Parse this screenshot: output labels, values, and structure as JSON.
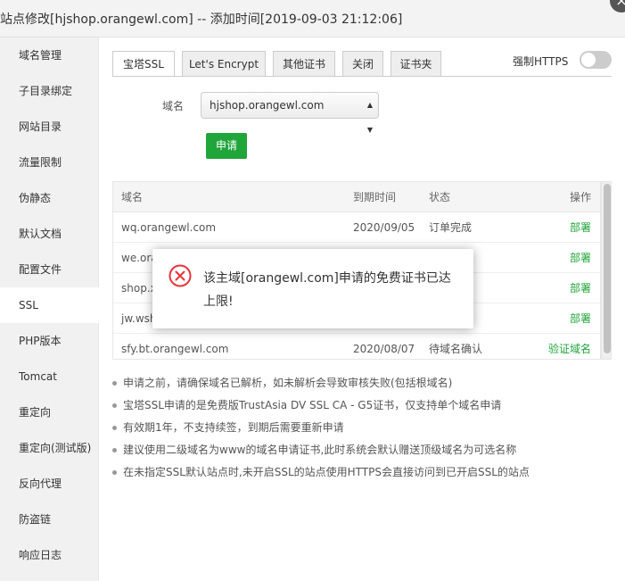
{
  "window": {
    "title": "站点修改[hjshop.orangewl.com] -- 添加时间[2019-09-03 21:12:06]",
    "close_label": "×"
  },
  "sidebar": {
    "items": [
      {
        "label": "域名管理"
      },
      {
        "label": "子目录绑定"
      },
      {
        "label": "网站目录"
      },
      {
        "label": "流量限制"
      },
      {
        "label": "伪静态"
      },
      {
        "label": "默认文档"
      },
      {
        "label": "配置文件"
      },
      {
        "label": "SSL",
        "active": true
      },
      {
        "label": "PHP版本"
      },
      {
        "label": "Tomcat"
      },
      {
        "label": "重定向"
      },
      {
        "label": "重定向(测试版)"
      },
      {
        "label": "反向代理"
      },
      {
        "label": "防盗链"
      },
      {
        "label": "响应日志"
      }
    ]
  },
  "tabs": [
    {
      "label": "宝塔SSL",
      "active": true
    },
    {
      "label": "Let's Encrypt"
    },
    {
      "label": "其他证书"
    },
    {
      "label": "关闭"
    },
    {
      "label": "证书夹"
    }
  ],
  "force_https": {
    "label": "强制HTTPS",
    "enabled": false
  },
  "domain_select": {
    "label": "域名",
    "value": "hjshop.orangewl.com"
  },
  "apply_button": {
    "label": "申请"
  },
  "cert_table": {
    "headers": {
      "domain": "域名",
      "expire": "到期时间",
      "status": "状态",
      "action": "操作"
    },
    "rows": [
      {
        "domain": "wq.orangewl.com",
        "expire": "2020/09/05",
        "status": "订单完成",
        "action": "部署"
      },
      {
        "domain": "we.orangewl.com",
        "expire": "",
        "status": "",
        "action": "部署"
      },
      {
        "domain": "shop.xxx",
        "expire": "",
        "status": "",
        "action": "部署"
      },
      {
        "domain": "jw.wsh",
        "expire": "",
        "status": "",
        "action": "部署"
      },
      {
        "domain": "sfy.bt.orangewl.com",
        "expire": "2020/08/07",
        "status": "待域名确认",
        "action": "验证域名"
      }
    ]
  },
  "notes": [
    "申请之前，请确保域名已解析，如未解析会导致审核失败(包括根域名)",
    "宝塔SSL申请的是免费版TrustAsia DV SSL CA - G5证书，仅支持单个域名申请",
    "有效期1年，不支持续签，到期后需要重新申请",
    "建议使用二级域名为www的域名申请证书,此时系统会默认赠送顶级域名为可选名称",
    "在未指定SSL默认站点时,未开启SSL的站点使用HTTPS会直接访问到已开启SSL的站点"
  ],
  "error_dialog": {
    "message": "该主域[orangewl.com]申请的免费证书已达上限!",
    "icon": "error-circle-x-icon"
  },
  "colors": {
    "accent": "#20a53a",
    "error": "#e8353b"
  }
}
